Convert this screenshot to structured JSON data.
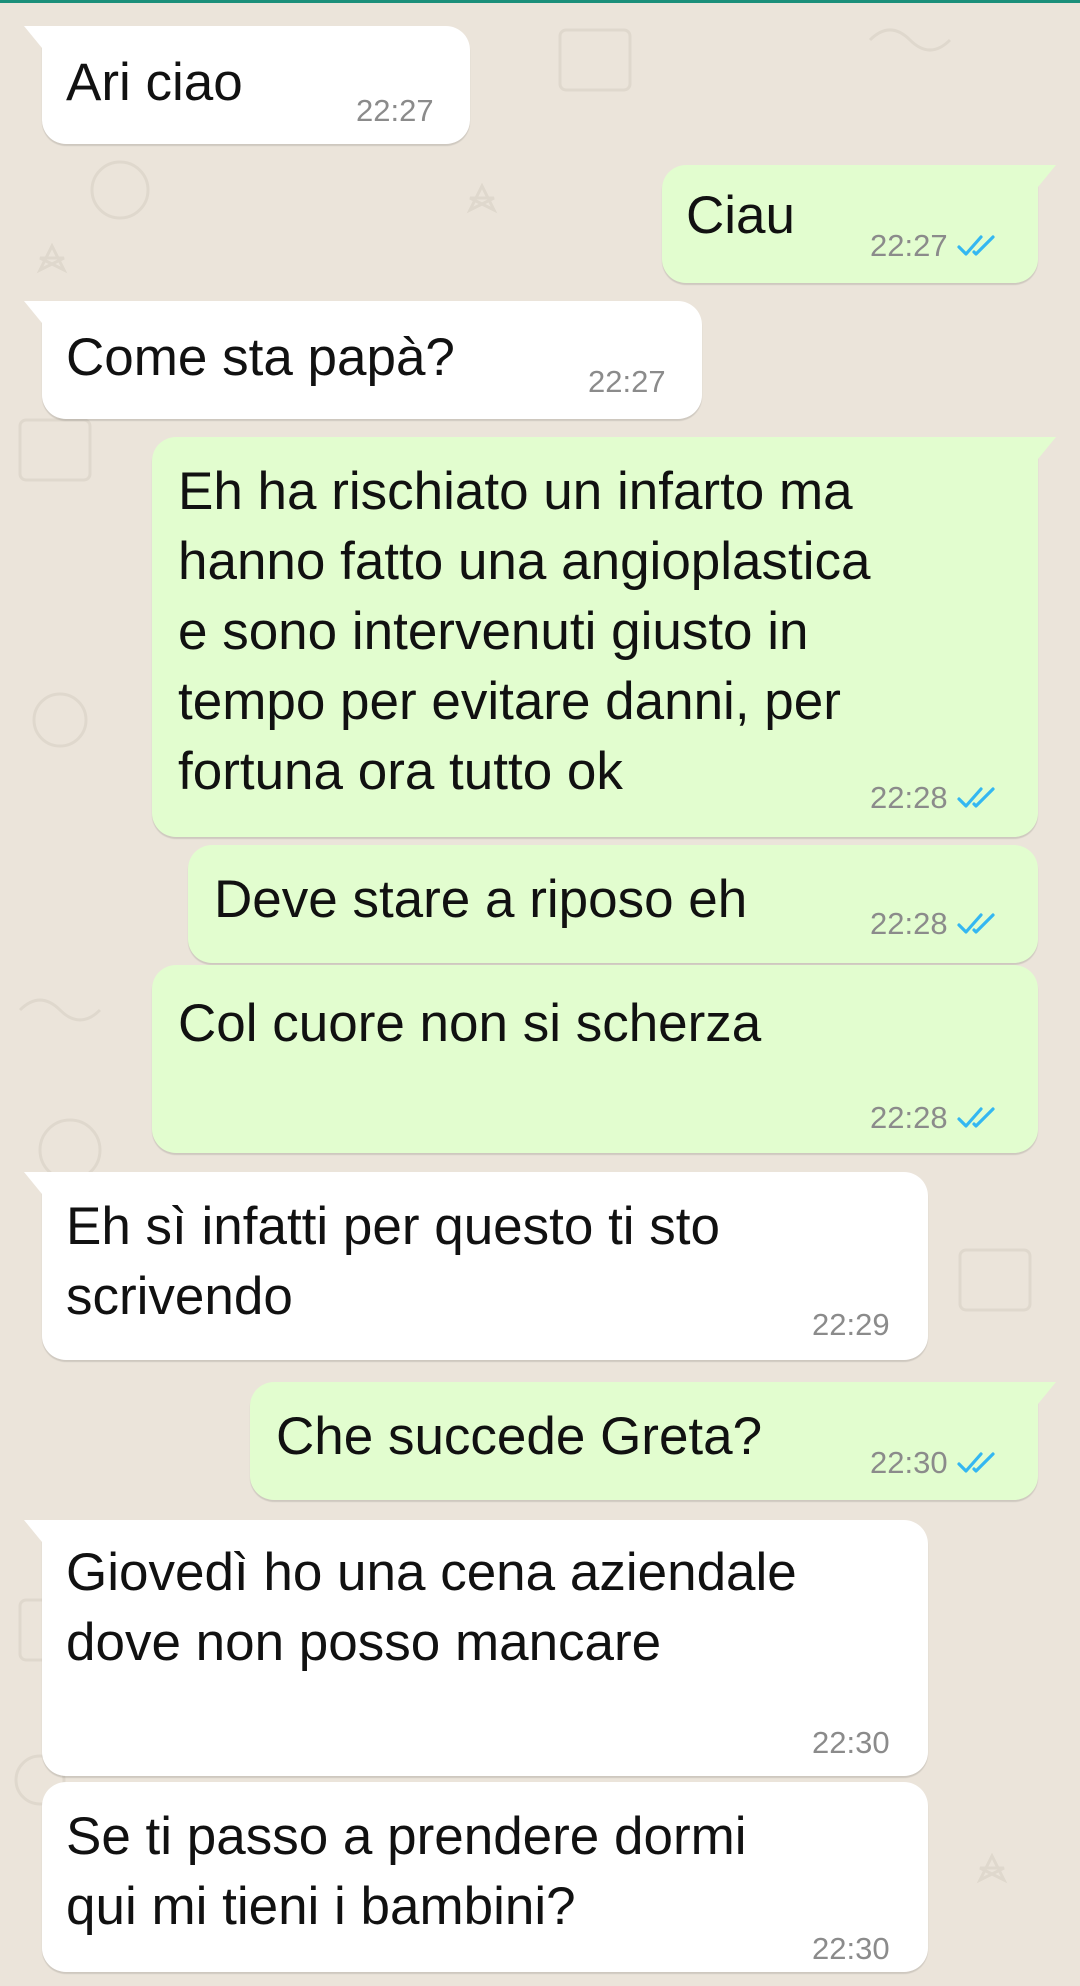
{
  "theme": {
    "in_bubble_color": "#ffffff",
    "out_bubble_color": "#e2fdcf",
    "read_tick_color": "#34b7f1",
    "timestamp_color": "#8b8b8b"
  },
  "messages": [
    {
      "direction": "in",
      "text": "Ari ciao",
      "time": "22:27"
    },
    {
      "direction": "out",
      "text": "Ciau",
      "time": "22:27",
      "status": "read-double-check-icon"
    },
    {
      "direction": "in",
      "text": "Come sta papà?",
      "time": "22:27"
    },
    {
      "direction": "out",
      "text": "Eh ha rischiato un infarto ma\nhanno fatto una angioplastica\ne sono intervenuti giusto in\ntempo per evitare danni, per\nfortuna ora tutto ok",
      "time": "22:28",
      "status": "read-double-check-icon"
    },
    {
      "direction": "out",
      "text": "Deve stare a riposo eh",
      "time": "22:28",
      "status": "read-double-check-icon"
    },
    {
      "direction": "out",
      "text": "Col cuore non si scherza",
      "time": "22:28",
      "status": "read-double-check-icon"
    },
    {
      "direction": "in",
      "text": "Eh sì infatti per questo ti sto\nscrivendo",
      "time": "22:29"
    },
    {
      "direction": "out",
      "text": "Che succede Greta?",
      "time": "22:30",
      "status": "read-double-check-icon"
    },
    {
      "direction": "in",
      "text": "Giovedì ho una cena aziendale\ndove non posso mancare",
      "time": "22:30"
    },
    {
      "direction": "in",
      "text": "Se ti passo a prendere dormi\nqui mi tieni i bambini?",
      "time": "22:30"
    }
  ]
}
